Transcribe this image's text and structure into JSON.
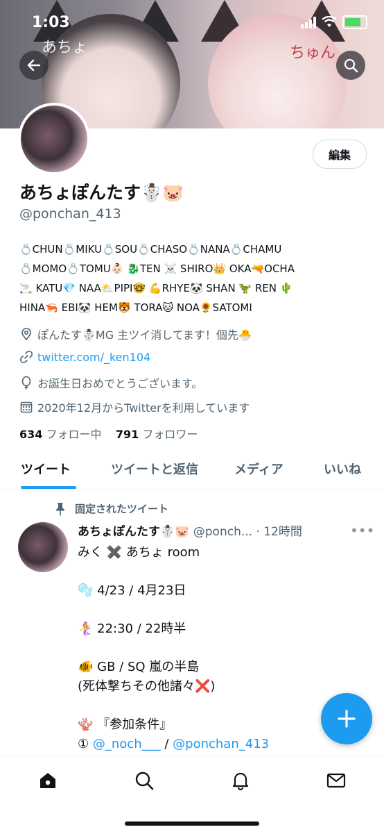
{
  "status_bar": {
    "time": "1:03"
  },
  "banner": {
    "left_text": "あちょ",
    "right_text": "ちゅん"
  },
  "profile": {
    "edit_label": "編集",
    "name": "あちょぽんたす☃️🐷",
    "handle": "@ponchan_413",
    "bio_lines": [
      "💍CHUN💍MIKU💍SOU💍CHASO💍NANA💍CHAMU",
      "💍MOMO💍TOMU👶🏻 🐉TEN ☠️ SHIRO👑 OKA🔫OCHA",
      "🚬 KATU💎 NAA⛅PIPI🤓 💪RHYE🐼 SHAN 🦖 REN 🌵",
      "HINA🦐 EBI🐼 HEM🐯 TORA🐱 NOA🌻SATOMI"
    ],
    "location": "ぽんたす☃️MG 主ツイ消してます！個先🐣",
    "url": "twitter.com/_ken104",
    "birthday": "お誕生日おめでとうございます。",
    "joined": "2020年12月からTwitterを利用しています",
    "following_count": "634",
    "following_label": "フォロー中",
    "followers_count": "791",
    "followers_label": "フォロワー"
  },
  "tabs": [
    "ツイート",
    "ツイートと返信",
    "メディア",
    "いいね"
  ],
  "pinned_tweet": {
    "pinned_label": "固定されたツイート",
    "name": "あちょぽんたす☃️🐷",
    "handle": "@ponch...",
    "time": "· 12時間",
    "lines": {
      "l1": "みく ✖️ あちょ room",
      "l2": "🫧 4/23 / 4月23日",
      "l3": "🧜‍♀️ 22:30 / 22時半",
      "l4a": "🐠 GB / SQ 嵐の半島",
      "l4b": "(死体撃ちその他諸々❌)",
      "l5": "🪸 『参加条件』",
      "l6_prefix": "①",
      "l6_link1": "@_noch___",
      "l6_sep": "/",
      "l6_link2": "@ponchan_413"
    }
  },
  "icons": {
    "back": "back-arrow-icon",
    "search": "search-icon",
    "pin": "pin-icon",
    "location": "location-icon",
    "link": "link-icon",
    "balloon": "balloon-icon",
    "calendar": "calendar-icon",
    "compose": "compose-plus-icon",
    "home": "home-icon",
    "explore": "search-icon",
    "notifications": "bell-icon",
    "messages": "mail-icon"
  },
  "colors": {
    "accent": "#1d9bf0",
    "text": "#0f1419",
    "secondary": "#536471"
  }
}
